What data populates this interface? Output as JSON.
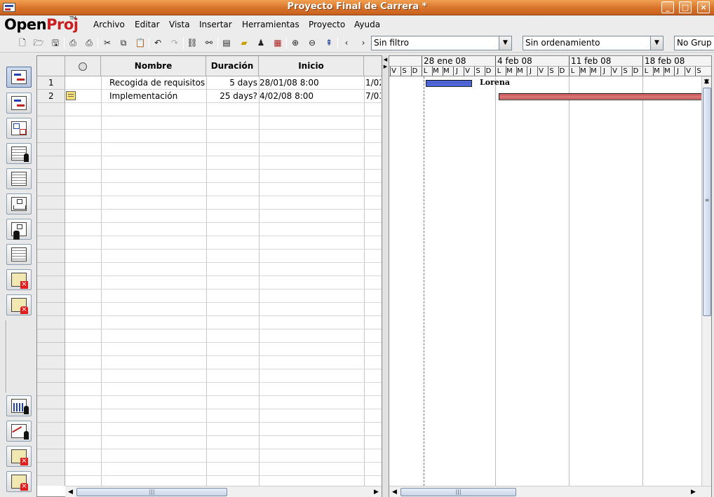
{
  "window": {
    "title": "Proyecto Final de Carrera *"
  },
  "logo": {
    "open": "Open",
    "proj": "Proj",
    "tm": "TM"
  },
  "menu": [
    "Archivo",
    "Editar",
    "Vista",
    "Insertar",
    "Herramientas",
    "Proyecto",
    "Ayuda"
  ],
  "toolbar": {
    "filter": "Sin filtro",
    "sort": "Sin ordenamiento",
    "group": "No Grup"
  },
  "table": {
    "columns": [
      "Nombre",
      "Duración",
      "Inicio"
    ],
    "tasks": [
      {
        "id": "1",
        "name": "Recogida de requisitos",
        "duration": "5 days",
        "start": "28/01/08 8:00",
        "finish": "1/02"
      },
      {
        "id": "2",
        "name": "Implementación",
        "duration": "25 days?",
        "start": "4/02/08 8:00",
        "finish": "7/03"
      }
    ]
  },
  "gantt": {
    "weeks": [
      "28 ene 08",
      "4 feb 08",
      "11 feb 08",
      "18 feb 08"
    ],
    "days": [
      "V",
      "S",
      "D",
      "L",
      "M",
      "M",
      "J",
      "V",
      "S",
      "D",
      "L",
      "M",
      "M",
      "J",
      "V",
      "S",
      "D",
      "L",
      "M",
      "M",
      "J",
      "V",
      "S",
      "D",
      "L",
      "M",
      "M",
      "J",
      "V",
      "S"
    ],
    "resource_label": "Lorena",
    "bar_colors": {
      "task": "#2d48c8",
      "critical": "#c03838"
    }
  }
}
